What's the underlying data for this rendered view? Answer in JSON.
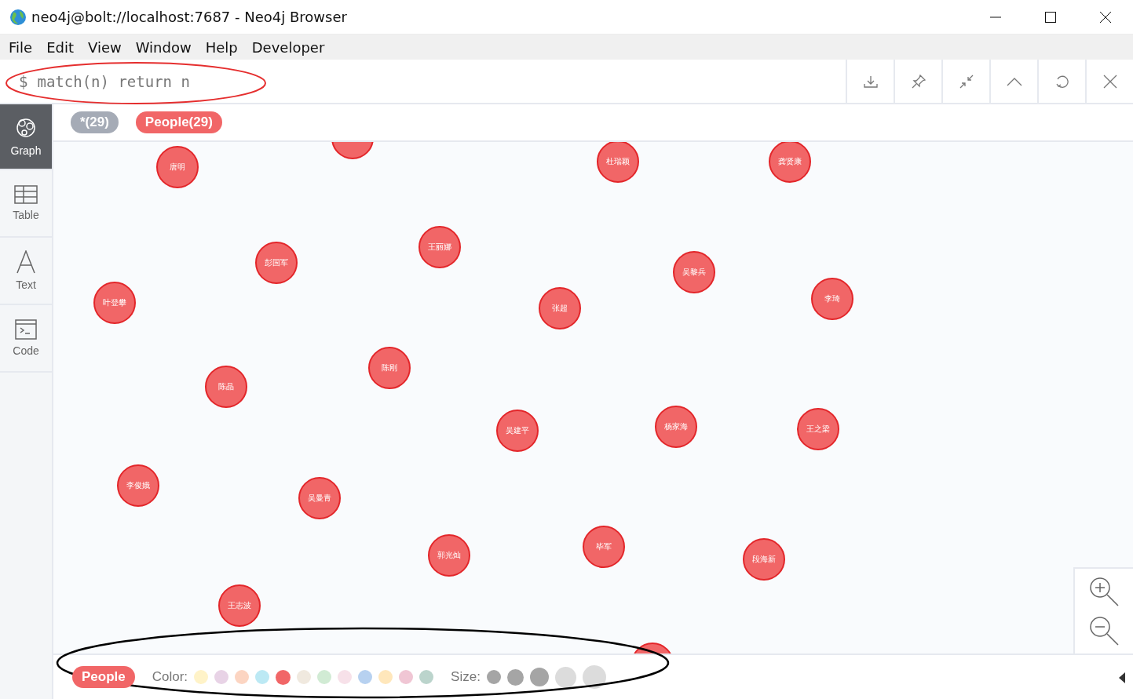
{
  "window": {
    "title": "neo4j@bolt://localhost:7687 - Neo4j Browser"
  },
  "menu": [
    "File",
    "Edit",
    "View",
    "Window",
    "Help",
    "Developer"
  ],
  "editor": {
    "prompt": "$",
    "query": "match(n) return n"
  },
  "sidebar": [
    {
      "label": "Graph",
      "kind": "graph",
      "selected": true
    },
    {
      "label": "Table",
      "kind": "table",
      "selected": false
    },
    {
      "label": "Text",
      "kind": "text",
      "selected": false
    },
    {
      "label": "Code",
      "kind": "code",
      "selected": false
    }
  ],
  "labels": [
    {
      "text": "*(29)",
      "kind": "all"
    },
    {
      "text": "People(29)",
      "kind": "label"
    }
  ],
  "nodes": [
    {
      "kind": "clipped"
    },
    {
      "kind": "node",
      "label": "唐明"
    },
    {
      "kind": "node",
      "label": "杜瑞颖"
    },
    {
      "kind": "node",
      "label": "龚贤康"
    },
    {
      "kind": "node",
      "label": "王丽娜"
    },
    {
      "kind": "node",
      "label": "彭国军"
    },
    {
      "kind": "node",
      "label": "吴黎兵"
    },
    {
      "kind": "node",
      "label": "叶登攀"
    },
    {
      "kind": "node",
      "label": "张超"
    },
    {
      "kind": "node",
      "label": "李琦"
    },
    {
      "kind": "node",
      "label": "陈刚"
    },
    {
      "kind": "node",
      "label": "陈晶"
    },
    {
      "kind": "node",
      "label": "吴建平"
    },
    {
      "kind": "node",
      "label": "杨家海"
    },
    {
      "kind": "node",
      "label": "王之梁"
    },
    {
      "kind": "node",
      "label": "李俊娥"
    },
    {
      "kind": "node",
      "label": "吴曼青"
    },
    {
      "kind": "node",
      "label": "郭光灿"
    },
    {
      "kind": "node",
      "label": "毕军"
    },
    {
      "kind": "node",
      "label": "段海新"
    },
    {
      "kind": "node",
      "label": "王志波"
    },
    {
      "kind": "clipped"
    }
  ],
  "legend": {
    "label": "People",
    "color_label": "Color:",
    "size_label": "Size:",
    "colors": [
      {
        "color": "#fff3c8",
        "selected": false
      },
      {
        "color": "#e8d3e6",
        "selected": false
      },
      {
        "color": "#fcd5c2",
        "selected": false
      },
      {
        "color": "#bce9f4",
        "selected": false
      },
      {
        "color": "#f16667",
        "selected": true
      },
      {
        "color": "#f0e9df",
        "selected": false
      },
      {
        "color": "#d1ebd4",
        "selected": false
      },
      {
        "color": "#f7e1e9",
        "selected": false
      },
      {
        "color": "#b7d1f0",
        "selected": false
      },
      {
        "color": "#ffe7bb",
        "selected": false
      },
      {
        "color": "#f0c6d4",
        "selected": false
      },
      {
        "color": "#bbd4cc",
        "selected": false
      }
    ],
    "sizes": [
      {
        "filled": true
      },
      {
        "filled": true
      },
      {
        "filled": true
      },
      {
        "filled": false
      },
      {
        "filled": false
      }
    ]
  }
}
